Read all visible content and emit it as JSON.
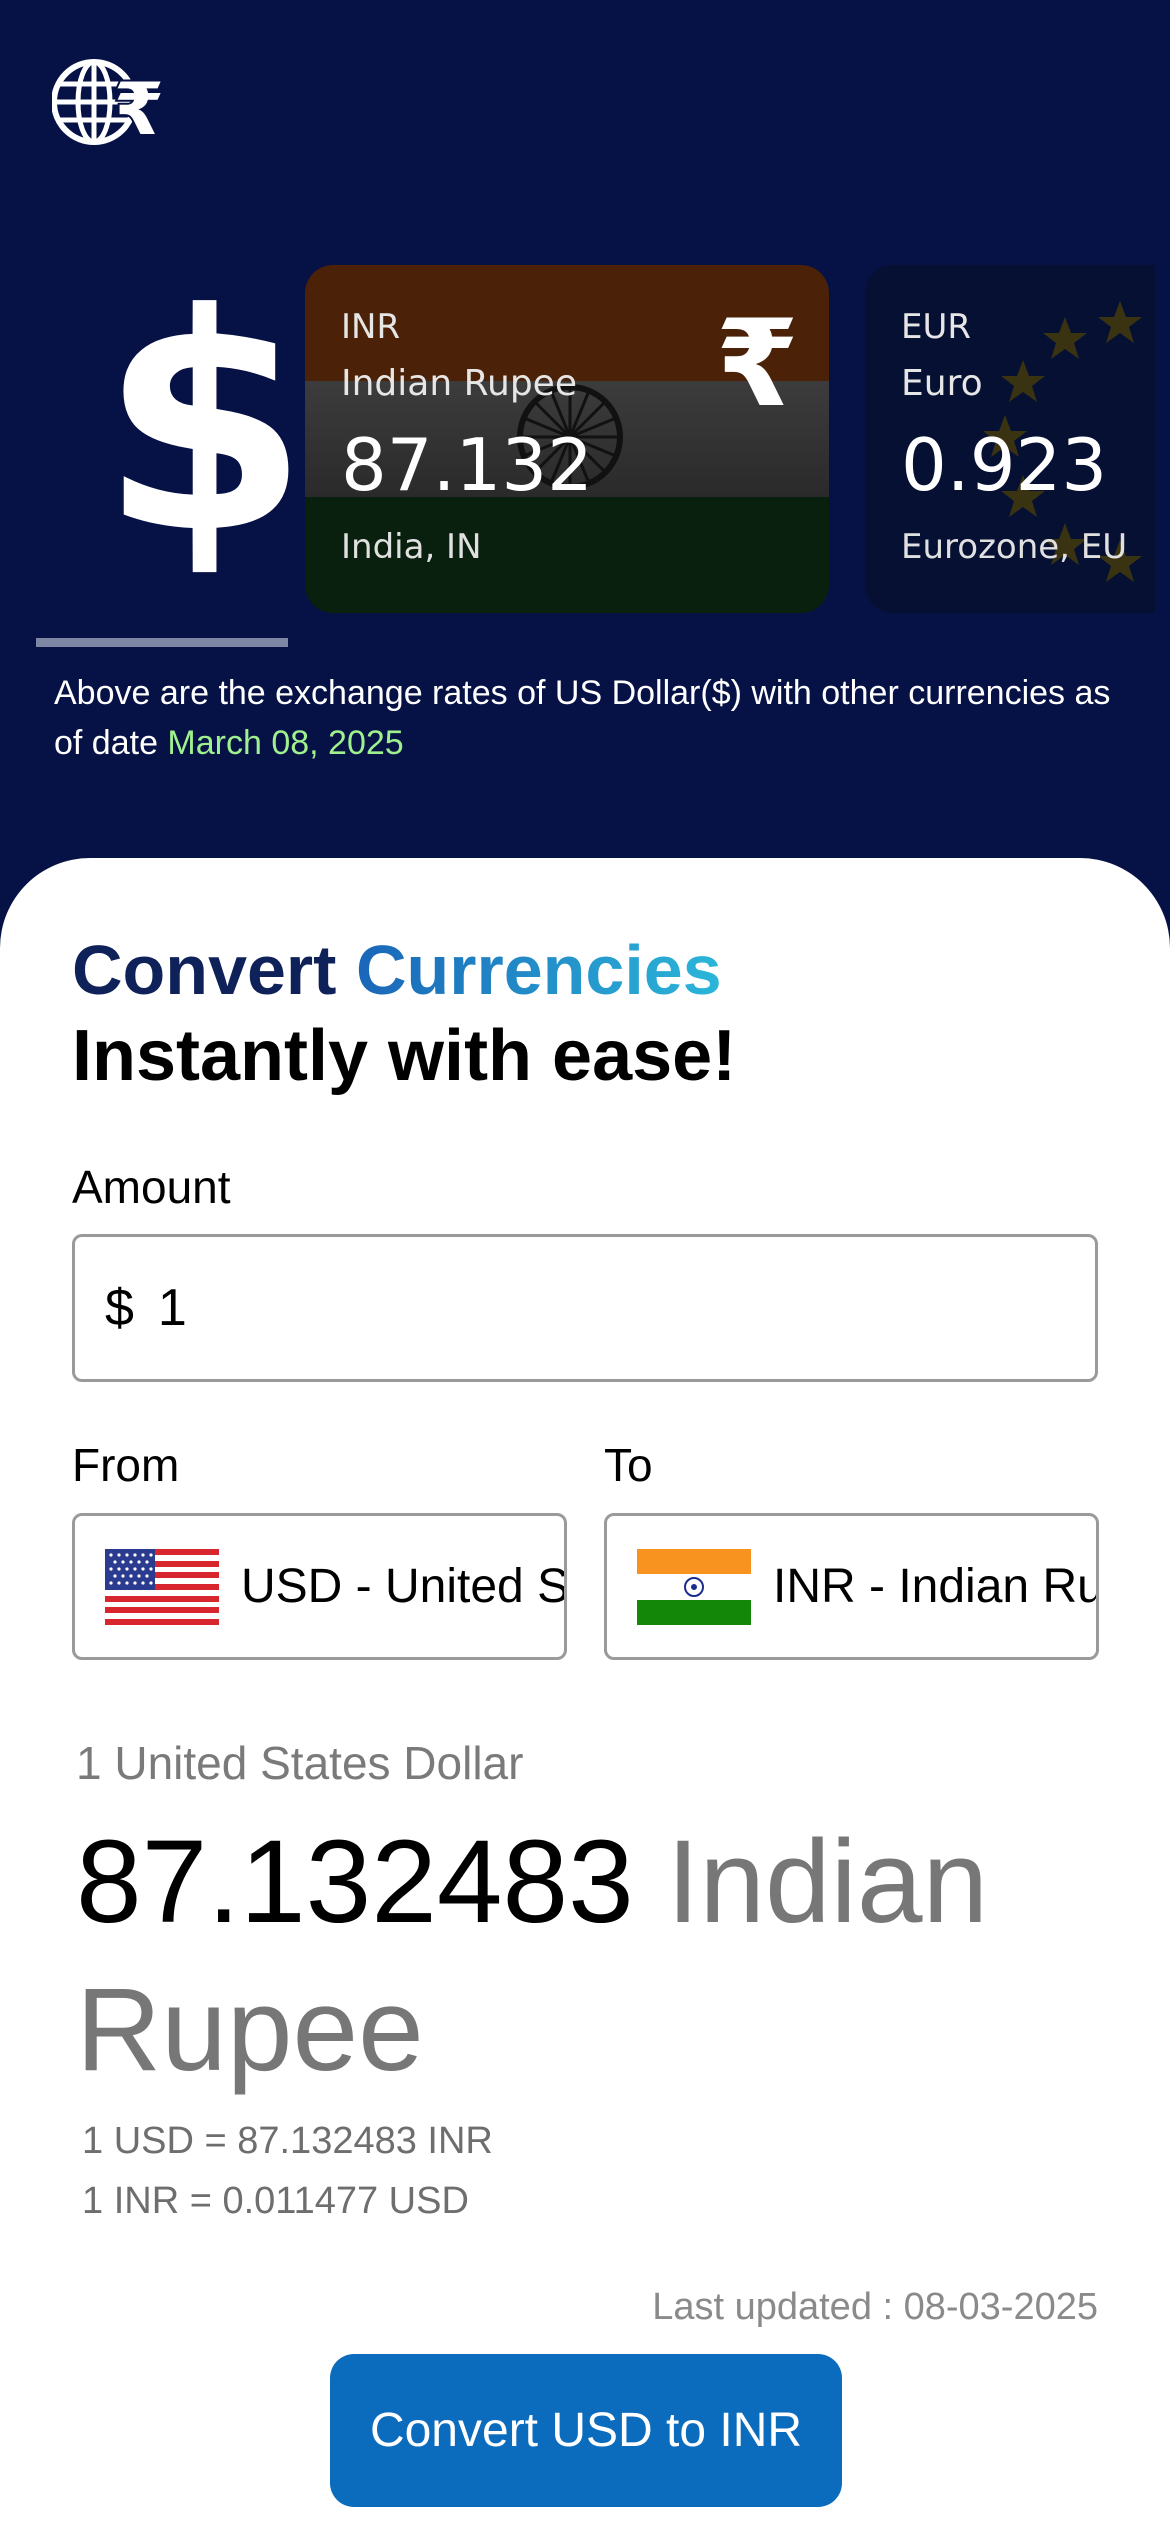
{
  "header": {
    "logo_icon": "globe-rupee-icon"
  },
  "hero": {
    "base_symbol": "$",
    "base_icon": "dollar-icon"
  },
  "rate_cards": [
    {
      "code": "INR",
      "name": "Indian Rupee",
      "rate": "87.132",
      "region": "India, IN",
      "symbol": "₹",
      "flag": "india-flag"
    },
    {
      "code": "EUR",
      "name": "Euro",
      "rate": "0.923",
      "region": "Eurozone, EU",
      "flag": "eu-flag"
    }
  ],
  "note": {
    "text": "Above are the exchange rates of US Dollar($) with other currencies as of date ",
    "date": "March 08, 2025",
    "date_color": "#9ff08e"
  },
  "converter": {
    "headline_part1": "Convert",
    "headline_part2": "Currencies",
    "headline_line2": "Instantly with ease!",
    "amount_label": "Amount",
    "amount_symbol": "$",
    "amount_value": "1",
    "from_label": "From",
    "to_label": "To",
    "from_value": "USD - United States Dollar",
    "to_value": "INR - Indian Rupee",
    "from_flag": "us-flag",
    "to_flag": "india-flag"
  },
  "result": {
    "from_text": "1 United States Dollar",
    "amount": "87.132483",
    "currency_name": "Indian Rupee",
    "rate_line1": "1 USD = 87.132483 INR",
    "rate_line2": "1 INR = 0.011477 USD",
    "last_updated": "Last updated : 08-03-2025"
  },
  "button": {
    "label": "Convert USD to INR",
    "color": "#0b6bbd"
  },
  "colors": {
    "background": "#061245",
    "panel": "#ffffff",
    "headline_dark": "#0f2159"
  }
}
